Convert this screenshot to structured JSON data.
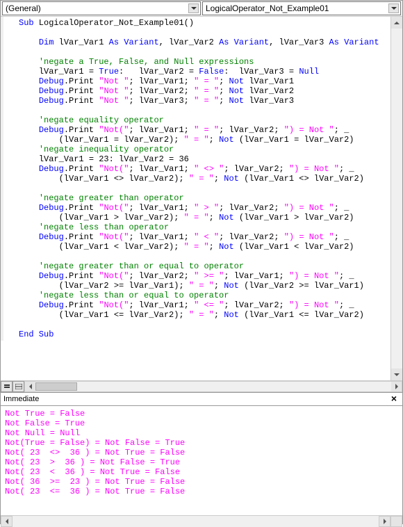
{
  "dropdowns": {
    "object": "(General)",
    "procedure": "LogicalOperator_Not_Example01"
  },
  "immediate": {
    "title": "Immediate",
    "lines": [
      "Not True = False",
      "Not False = True",
      "Not Null = Null",
      "Not(True = False) = Not False = True",
      "Not( 23  <>  36 ) = Not True = False",
      "Not( 23  >  36 ) = Not False = True",
      "Not( 23  <  36 ) = Not True = False",
      "Not( 36  >=  23 ) = Not True = False",
      "Not( 23  <=  36 ) = Not True = False"
    ]
  },
  "code": {
    "sub_decl": {
      "sub": "Sub",
      "name": " LogicalOperator_Not_Example01()"
    },
    "dim_line": {
      "dim": "Dim",
      "v1": " lVar_Var1 ",
      "as": "As Variant",
      "c": ", lVar_Var2 ",
      "c2": ", lVar_Var3 "
    },
    "cmt1": "'negate a True, False, and Null expressions",
    "assign1": {
      "a": "lVar_Var1 = ",
      "t": "True",
      "b": ":   lVar_Var2 = ",
      "f": "False",
      "c": ":  lVar_Var3 = ",
      "n": "Null"
    },
    "dp": "Debug",
    "print": ".Print ",
    "not_str": "\"Not \"",
    "eq_str": "\" = \"",
    "semicolon": "; ",
    "not_kw": "Not",
    "v1": " lVar_Var1",
    "v2": " lVar_Var2",
    "v3": " lVar_Var3",
    "cmt2": "'negate equality operator",
    "noteq_open": "\"Not(\"",
    "close_paren": "\") = Not \"",
    "under": "; _",
    "cmt3": "'negate inequality operator",
    "assign2": {
      "a": "lVar_Var1 = ",
      "n1": "23",
      "b": ": lVar_Var2 = ",
      "n2": "36"
    },
    "neq_str": "\" <> \"",
    "cmt4": "'negate greater than operator",
    "gt_str": "\" > \"",
    "cmt5": "'negate less than operator",
    "lt_str": "\" < \"",
    "cmt6": "'negate greater than or equal to operator",
    "gte_str": "\" >= \"",
    "cmt7": "'negate less than or equal to operator",
    "lte_str": "\" <= \"",
    "end_sub": "End Sub"
  }
}
